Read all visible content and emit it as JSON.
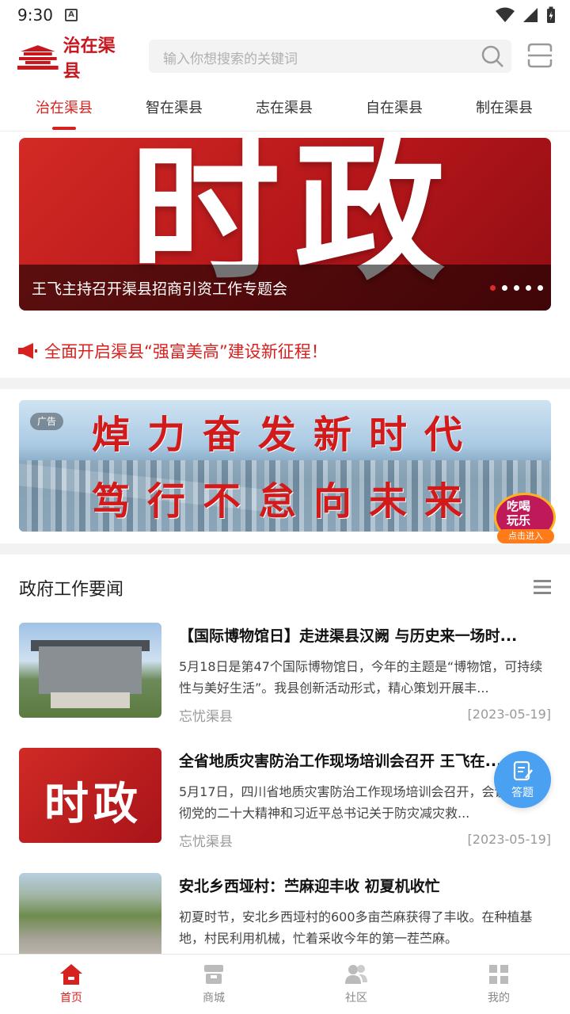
{
  "status_bar": {
    "time": "9:30",
    "notification_icon": "A"
  },
  "header": {
    "logo_text": "治在渠县",
    "search_placeholder": "输入你想搜索的关键词"
  },
  "tabs": [
    {
      "label": "治在渠县",
      "active": true
    },
    {
      "label": "智在渠县",
      "active": false
    },
    {
      "label": "志在渠县",
      "active": false
    },
    {
      "label": "自在渠县",
      "active": false
    },
    {
      "label": "制在渠县",
      "active": false
    }
  ],
  "banner": {
    "image_text": "时政",
    "caption": "王飞主持召开渠县招商引资工作专题会",
    "slide_count": 5,
    "active_slide": 1
  },
  "notice": {
    "text": "全面开启渠县“强富美高”建设新征程！"
  },
  "ad": {
    "tag": "广告",
    "line1": "焯力奋发新时代",
    "line2": "笃行不怠向未来",
    "promo_line1": "吃喝",
    "promo_line2": "玩乐",
    "promo_cta": "点击进入"
  },
  "section": {
    "title": "政府工作要闻"
  },
  "news": [
    {
      "title": "【国际博物馆日】走进渠县汉阙 与历史来一场时...",
      "desc": "5月18日是第47个国际博物馆日，今年的主题是“博物馆，可持续性与美好生活”。我县创新活动形式，精心策划开展丰...",
      "source": "忘忧渠县",
      "date": "[2023-05-19]"
    },
    {
      "title": "全省地质灾害防治工作现场培训会召开 王飞在...",
      "thumb_text": "时政",
      "desc": "5月17日，四川省地质灾害防治工作现场培训会召开，会议学习贯彻党的二十大精神和习近平总书记关于防灾减灾救...",
      "source": "忘忧渠县",
      "date": "[2023-05-19]"
    },
    {
      "title": "安北乡西垭村：苎麻迎丰收 初夏机收忙",
      "desc": "初夏时节，安北乡西垭村的600多亩苎麻获得了丰收。在种植基地，村民利用机械，忙着采收今年的第一茬苎麻。",
      "source": "",
      "date": ""
    }
  ],
  "fab": {
    "label": "答题"
  },
  "bottom_nav": [
    {
      "label": "首页",
      "icon": "home-icon",
      "active": true
    },
    {
      "label": "商城",
      "icon": "shop-icon",
      "active": false
    },
    {
      "label": "社区",
      "icon": "community-icon",
      "active": false
    },
    {
      "label": "我的",
      "icon": "profile-icon",
      "active": false
    }
  ],
  "colors": {
    "accent": "#d6211f",
    "fab": "#4aa1f2"
  }
}
